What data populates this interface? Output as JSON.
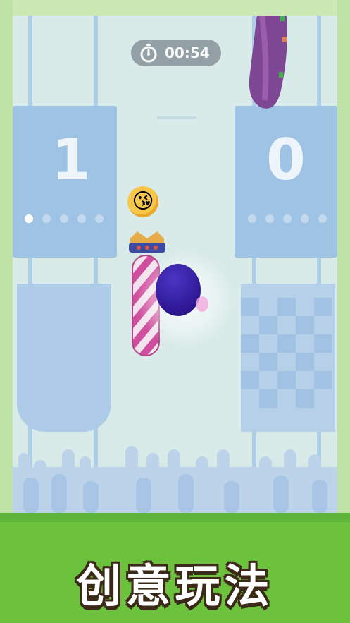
{
  "timer": {
    "value": "00:54",
    "icon": "stopwatch-icon"
  },
  "scoreboard": {
    "left_score": "1",
    "right_score": "0"
  },
  "progress_dots": {
    "left_total": 5,
    "left_active": 1,
    "right_total": 5,
    "right_active": 0
  },
  "emote": {
    "icon": "kissing-face-emoji",
    "glyph": "😘"
  },
  "caption": {
    "text": "创意玩法"
  },
  "colors": {
    "grass": "#6cc23d",
    "arena": "#d8ebe9",
    "ball": "#3a1f9e",
    "candy_stripe": "#d04f9a"
  }
}
